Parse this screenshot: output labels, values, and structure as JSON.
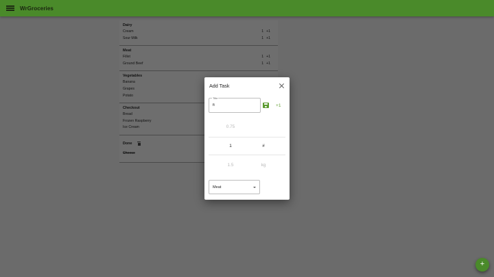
{
  "app": {
    "title": "WrGroceries"
  },
  "sections": [
    {
      "title": "Dairy",
      "items": [
        {
          "name": "Cream",
          "qty": "1",
          "inc": "+1"
        },
        {
          "name": "Sour Milk",
          "qty": "1",
          "inc": "+1"
        }
      ]
    },
    {
      "title": "Meat",
      "items": [
        {
          "name": "Fillet",
          "qty": "1",
          "inc": "+1"
        },
        {
          "name": "Ground Beef",
          "qty": "1",
          "inc": "+1"
        }
      ]
    },
    {
      "title": "Vegetables",
      "items": [
        {
          "name": "Banana"
        },
        {
          "name": "Grapes"
        },
        {
          "name": "Potato"
        }
      ]
    },
    {
      "title": "Checkout",
      "items": [
        {
          "name": "Bread"
        },
        {
          "name": "Frozen Raspberry"
        },
        {
          "name": "Ice Cream"
        }
      ]
    }
  ],
  "done": {
    "title": "Done",
    "items": [
      {
        "name": "Cheese"
      }
    ]
  },
  "dialog": {
    "title": "Add Task",
    "field_label": "Title",
    "field_value": "fi",
    "plus_one": "+1",
    "picker": {
      "amounts": [
        "0.75",
        "1",
        "1.5"
      ],
      "units": [
        "",
        "#",
        "kg"
      ],
      "selected_amount": "1",
      "selected_unit": "#"
    },
    "category": "Meat"
  },
  "fab": {
    "label": "+"
  },
  "colors": {
    "primary": "#4a8a2a",
    "accent": "#6aa23a"
  }
}
